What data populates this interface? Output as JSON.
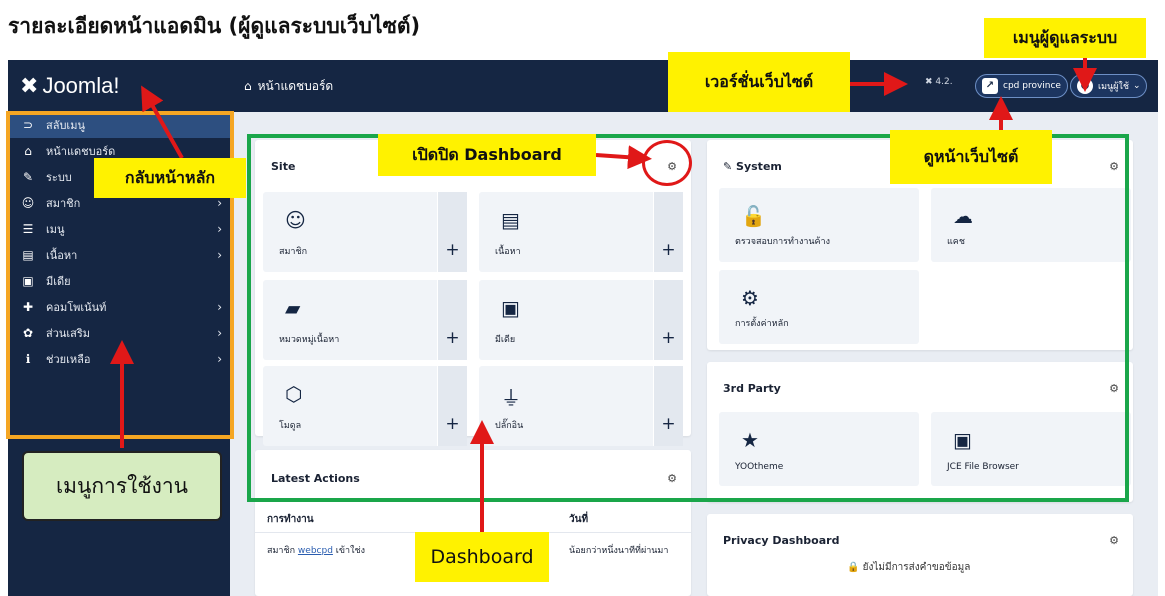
{
  "doc_title": "รายละเอียดหน้าแอดมิน (ผู้ดูแลระบบเว็บไซต์)",
  "brand": "Joomla!",
  "topbar": {
    "heading": "หน้าแดชบอร์ด",
    "version": "4.2.",
    "site_button": "cpd province",
    "user_button": "เมนูผู้ใช้"
  },
  "sidebar": {
    "items": [
      {
        "label": "สลับเมนู",
        "icon": "toggle-icon",
        "glyph": "⊃",
        "chevron": false
      },
      {
        "label": "หน้าแดชบอร์ด",
        "icon": "home-icon",
        "glyph": "⌂",
        "chevron": false
      },
      {
        "label": "ระบบ",
        "icon": "wrench-icon",
        "glyph": "✎",
        "chevron": false
      },
      {
        "label": "สมาชิก",
        "icon": "users-icon",
        "glyph": "☺",
        "chevron": true
      },
      {
        "label": "เมนู",
        "icon": "list-icon",
        "glyph": "☰",
        "chevron": true
      },
      {
        "label": "เนื้อหา",
        "icon": "file-icon",
        "glyph": "▤",
        "chevron": true
      },
      {
        "label": "มีเดีย",
        "icon": "image-icon",
        "glyph": "▣",
        "chevron": false
      },
      {
        "label": "คอมโพเน้นท์",
        "icon": "puzzle-icon",
        "glyph": "✚",
        "chevron": true
      },
      {
        "label": "ส่วนเสริม",
        "icon": "cubes-icon",
        "glyph": "✿",
        "chevron": true
      },
      {
        "label": "ช่วยเหลือ",
        "icon": "info-icon",
        "glyph": "ℹ",
        "chevron": true
      }
    ]
  },
  "site_card": {
    "title": "Site",
    "tiles": [
      {
        "label": "สมาชิก",
        "glyph": "☺"
      },
      {
        "label": "เนื้อหา",
        "glyph": "▤"
      },
      {
        "label": "หมวดหมู่เนื้อหา",
        "glyph": "▰"
      },
      {
        "label": "มีเดีย",
        "glyph": "▣"
      },
      {
        "label": "โมดูล",
        "glyph": "⬡"
      },
      {
        "label": "ปลั๊กอิน",
        "glyph": "⏚"
      }
    ]
  },
  "system_card": {
    "title": "System",
    "tiles": [
      {
        "label": "ตรวจสอบการทำงานค้าง",
        "glyph": "🔓"
      },
      {
        "label": "แคช",
        "glyph": "☁"
      },
      {
        "label": "การตั้งค่าหลัก",
        "glyph": "⚙"
      }
    ]
  },
  "third_party_card": {
    "title": "3rd Party",
    "tiles": [
      {
        "label": "YOOtheme",
        "glyph": "★"
      },
      {
        "label": "JCE File Browser",
        "glyph": "▣"
      }
    ]
  },
  "latest_actions": {
    "title": "Latest Actions",
    "col_action": "การทำงาน",
    "col_date": "วันที่",
    "row_prefix": "สมาชิก",
    "row_user": "webcpd",
    "row_suffix": "เข้าใช่ง",
    "row_date": "น้อยกว่าหนึ่งนาทีที่ผ่านมา"
  },
  "privacy": {
    "title": "Privacy Dashboard",
    "message": "ยังไม่มีการส่งคำขอข้อมูล"
  },
  "annotations": {
    "back_home": "กลับหน้าหลัก",
    "toggle_dashboard": "เปิดปิด Dashboard",
    "site_version": "เวอร์ชั่นเว็บไซต์",
    "admin_menu": "เมนูผู้ดูแลระบบ",
    "view_site": "ดูหน้าเว็บไซต์",
    "usage_menu": "เมนูการใช้งาน",
    "dashboard": "Dashboard"
  },
  "colors": {
    "sidebar": "#152643",
    "highlight": "#fff200",
    "frame_orange": "#f5a623",
    "frame_green": "#1aa64a",
    "arrow_red": "#e01818"
  }
}
